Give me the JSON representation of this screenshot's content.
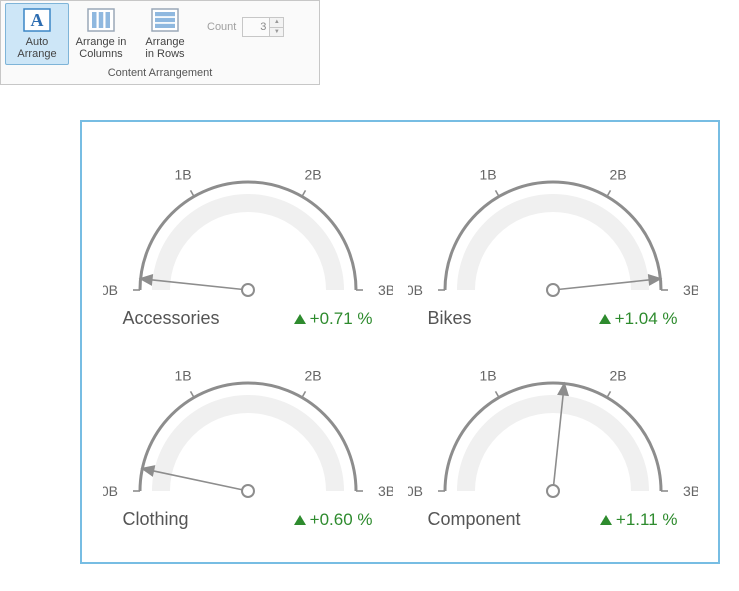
{
  "ribbon": {
    "group_title": "Content Arrangement",
    "buttons": [
      {
        "id": "auto-arrange",
        "label": "Auto Arrange",
        "selected": true
      },
      {
        "id": "arrange-columns",
        "label": "Arrange in\nColumns",
        "selected": false
      },
      {
        "id": "arrange-rows",
        "label": "Arrange\nin Rows",
        "selected": false
      }
    ],
    "count_label": "Count",
    "count_value": "3"
  },
  "chart_data": {
    "type": "gauge",
    "axis": {
      "min": 0,
      "max": 3,
      "unit": "B",
      "ticks": [
        0,
        1,
        2,
        3
      ],
      "tick_labels": [
        "0B",
        "1B",
        "2B",
        "3B"
      ]
    },
    "gauges": [
      {
        "name": "Accessories",
        "value": 0.1,
        "delta": "+0.71 %",
        "trend": "up"
      },
      {
        "name": "Bikes",
        "value": 2.9,
        "delta": "+1.04 %",
        "trend": "up"
      },
      {
        "name": "Clothing",
        "value": 0.2,
        "delta": "+0.60 %",
        "trend": "up"
      },
      {
        "name": "Component",
        "value": 1.6,
        "delta": "+1.11 %",
        "trend": "up"
      }
    ]
  }
}
